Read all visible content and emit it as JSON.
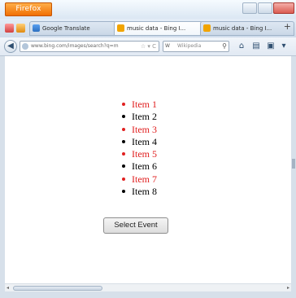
{
  "browser": {
    "app_button_label": "Firefox",
    "tabs": [
      {
        "label": "Google Translate"
      },
      {
        "label": "music data - Bing I..."
      },
      {
        "label": "music data - Bing I..."
      }
    ],
    "url": "www.bing.com/images/search?q=m",
    "search_engine": "W",
    "search_placeholder": "Wikipedia"
  },
  "page": {
    "items": [
      {
        "label": "Item 1",
        "color": "red"
      },
      {
        "label": "Item 2",
        "color": "black"
      },
      {
        "label": "Item 3",
        "color": "red"
      },
      {
        "label": "Item 4",
        "color": "black"
      },
      {
        "label": "Item 5",
        "color": "red"
      },
      {
        "label": "Item 6",
        "color": "black"
      },
      {
        "label": "Item 7",
        "color": "red"
      },
      {
        "label": "Item 8",
        "color": "black"
      }
    ],
    "button_label": "Select Event"
  },
  "colors": {
    "accent_red": "#e02020",
    "firefox_orange": "#f06c00"
  }
}
